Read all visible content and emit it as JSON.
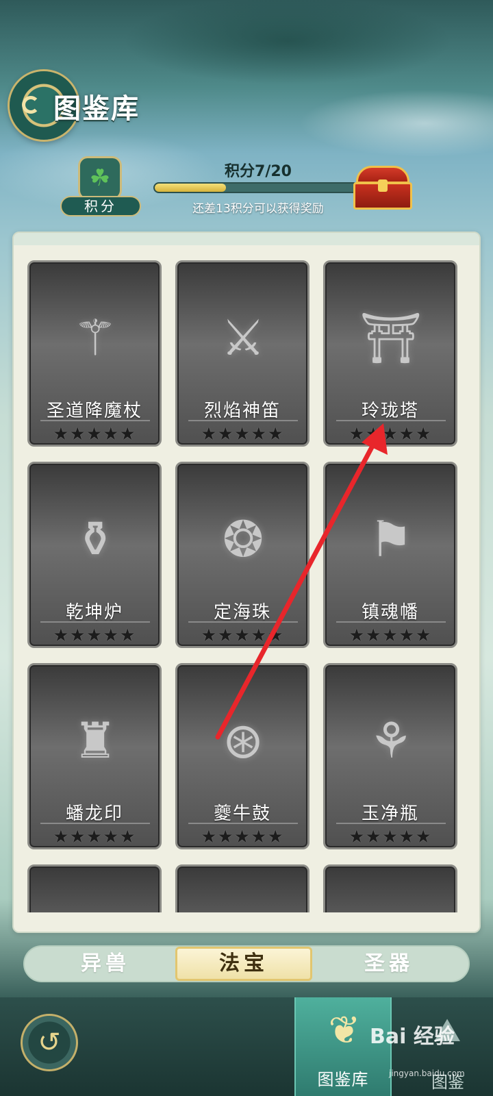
{
  "header": {
    "title": "图鉴库"
  },
  "score": {
    "badge_label": "积分",
    "progress_title": "积分7/20",
    "progress_fraction": 0.35,
    "progress_hint": "还差13积分可以获得奖励"
  },
  "cards": [
    {
      "name": "圣道降魔杖",
      "stars": "★★★★★",
      "icon": "staff-icon"
    },
    {
      "name": "烈焰神笛",
      "stars": "★★★★★",
      "icon": "flute-icon"
    },
    {
      "name": "玲珑塔",
      "stars": "★★★★★",
      "icon": "pagoda-icon"
    },
    {
      "name": "乾坤炉",
      "stars": "★★★★★",
      "icon": "furnace-icon"
    },
    {
      "name": "定海珠",
      "stars": "★★★★★",
      "icon": "pearl-icon"
    },
    {
      "name": "镇魂幡",
      "stars": "★★★★★",
      "icon": "banner-icon"
    },
    {
      "name": "蟠龙印",
      "stars": "★★★★★",
      "icon": "dragon-seal-icon"
    },
    {
      "name": "夔牛鼓",
      "stars": "★★★★★",
      "icon": "drum-icon"
    },
    {
      "name": "玉净瓶",
      "stars": "★★★★★",
      "icon": "vase-icon"
    }
  ],
  "tabs": [
    {
      "label": "异兽",
      "active": false
    },
    {
      "label": "法宝",
      "active": true
    },
    {
      "label": "圣器",
      "active": false
    }
  ],
  "bottom_nav": {
    "active_label": "图鉴库",
    "second_label": "图鉴"
  },
  "watermark": {
    "text": "Bai 经验",
    "sub": "jingyan.baidu.com"
  },
  "colors": {
    "accent": "#2f7b6f",
    "arrow": "#e8262b",
    "gold": "#d7b43c"
  }
}
